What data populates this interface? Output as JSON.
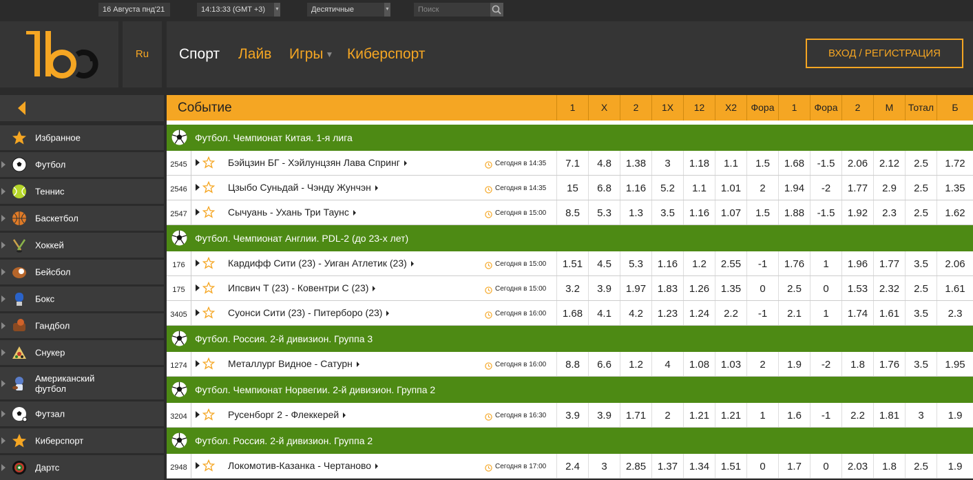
{
  "topbar": {
    "date": "16 Августа пнд'21",
    "time": "14:13:33 (GMT +3)",
    "odds_format": "Десятичные",
    "search_placeholder": "Поиск"
  },
  "header": {
    "lang": "Ru",
    "nav": [
      "Спорт",
      "Лайв",
      "Игры",
      "Киберспорт"
    ],
    "login": "ВХОД / РЕГИСТРАЦИЯ"
  },
  "colors": {
    "accent": "#f5a623",
    "league_green": "#4d8a14",
    "bg": "#2b2b2b"
  },
  "sidebar": {
    "items": [
      {
        "label": "Избранное",
        "icon": "star-icon"
      },
      {
        "label": "Футбол",
        "icon": "soccer-ball-icon"
      },
      {
        "label": "Теннис",
        "icon": "tennis-ball-icon"
      },
      {
        "label": "Баскетбол",
        "icon": "basketball-icon"
      },
      {
        "label": "Хоккей",
        "icon": "hockey-icon"
      },
      {
        "label": "Бейсбол",
        "icon": "baseball-icon"
      },
      {
        "label": "Бокс",
        "icon": "boxing-glove-icon"
      },
      {
        "label": "Гандбол",
        "icon": "handball-icon"
      },
      {
        "label": "Снукер",
        "icon": "snooker-icon"
      },
      {
        "label": "Американский футбол",
        "icon": "american-football-icon"
      },
      {
        "label": "Футзал",
        "icon": "futsal-icon"
      },
      {
        "label": "Киберспорт",
        "icon": "star-icon"
      },
      {
        "label": "Дартс",
        "icon": "darts-icon"
      }
    ]
  },
  "table": {
    "event_header": "Событие",
    "columns": [
      "1",
      "X",
      "2",
      "1X",
      "12",
      "X2",
      "Фора",
      "1",
      "Фора",
      "2",
      "М",
      "Тотал",
      "Б"
    ],
    "leagues": [
      {
        "name": "Футбол. Чемпионат Китая. 1-я лига",
        "matches": [
          {
            "num": "2545",
            "teams": "Бэйцзин БГ - Хэйлунцзян Лава Спринг",
            "time": "Сегодня в 14:35",
            "odds": [
              "7.1",
              "4.8",
              "1.38",
              "3",
              "1.18",
              "1.1",
              "1.5",
              "1.68",
              "-1.5",
              "2.06",
              "2.12",
              "2.5",
              "1.72"
            ]
          },
          {
            "num": "2546",
            "teams": "Цзыбо Суньдай - Чэнду Жунчэн",
            "time": "Сегодня в 14:35",
            "odds": [
              "15",
              "6.8",
              "1.16",
              "5.2",
              "1.1",
              "1.01",
              "2",
              "1.94",
              "-2",
              "1.77",
              "2.9",
              "2.5",
              "1.35"
            ]
          },
          {
            "num": "2547",
            "teams": "Сычуань - Ухань Три Таунс",
            "time": "Сегодня в 15:00",
            "odds": [
              "8.5",
              "5.3",
              "1.3",
              "3.5",
              "1.16",
              "1.07",
              "1.5",
              "1.88",
              "-1.5",
              "1.92",
              "2.3",
              "2.5",
              "1.62"
            ]
          }
        ]
      },
      {
        "name": "Футбол. Чемпионат Англии. PDL-2 (до 23-х лет)",
        "matches": [
          {
            "num": "176",
            "teams": "Кардифф Сити (23) - Уиган Атлетик (23)",
            "time": "Сегодня в 15:00",
            "odds": [
              "1.51",
              "4.5",
              "5.3",
              "1.16",
              "1.2",
              "2.55",
              "-1",
              "1.76",
              "1",
              "1.96",
              "1.77",
              "3.5",
              "2.06"
            ]
          },
          {
            "num": "175",
            "teams": "Ипсвич Т (23) - Ковентри С (23)",
            "time": "Сегодня в 15:00",
            "odds": [
              "3.2",
              "3.9",
              "1.97",
              "1.83",
              "1.26",
              "1.35",
              "0",
              "2.5",
              "0",
              "1.53",
              "2.32",
              "2.5",
              "1.61"
            ]
          },
          {
            "num": "3405",
            "teams": "Суонси Сити (23) - Питерборо (23)",
            "time": "Сегодня в 16:00",
            "odds": [
              "1.68",
              "4.1",
              "4.2",
              "1.23",
              "1.24",
              "2.2",
              "-1",
              "2.1",
              "1",
              "1.74",
              "1.61",
              "3.5",
              "2.3"
            ]
          }
        ]
      },
      {
        "name": "Футбол. Россия. 2-й дивизион. Группа 3",
        "matches": [
          {
            "num": "1274",
            "teams": "Металлург Видное - Сатурн",
            "time": "Сегодня в 16:00",
            "odds": [
              "8.8",
              "6.6",
              "1.2",
              "4",
              "1.08",
              "1.03",
              "2",
              "1.9",
              "-2",
              "1.8",
              "1.76",
              "3.5",
              "1.95"
            ]
          }
        ]
      },
      {
        "name": "Футбол. Чемпионат Норвегии. 2-й дивизион. Группа 2",
        "matches": [
          {
            "num": "3204",
            "teams": "Русенборг 2 - Флеккерей",
            "time": "Сегодня в 16:30",
            "odds": [
              "3.9",
              "3.9",
              "1.71",
              "2",
              "1.21",
              "1.21",
              "1",
              "1.6",
              "-1",
              "2.2",
              "1.81",
              "3",
              "1.9"
            ]
          }
        ]
      },
      {
        "name": "Футбол. Россия. 2-й дивизион. Группа 2",
        "matches": [
          {
            "num": "2948",
            "teams": "Локомотив-Казанка - Чертаново",
            "time": "Сегодня в 17:00",
            "odds": [
              "2.4",
              "3",
              "2.85",
              "1.37",
              "1.34",
              "1.51",
              "0",
              "1.7",
              "0",
              "2.03",
              "1.8",
              "2.5",
              "1.9"
            ]
          }
        ]
      }
    ]
  }
}
